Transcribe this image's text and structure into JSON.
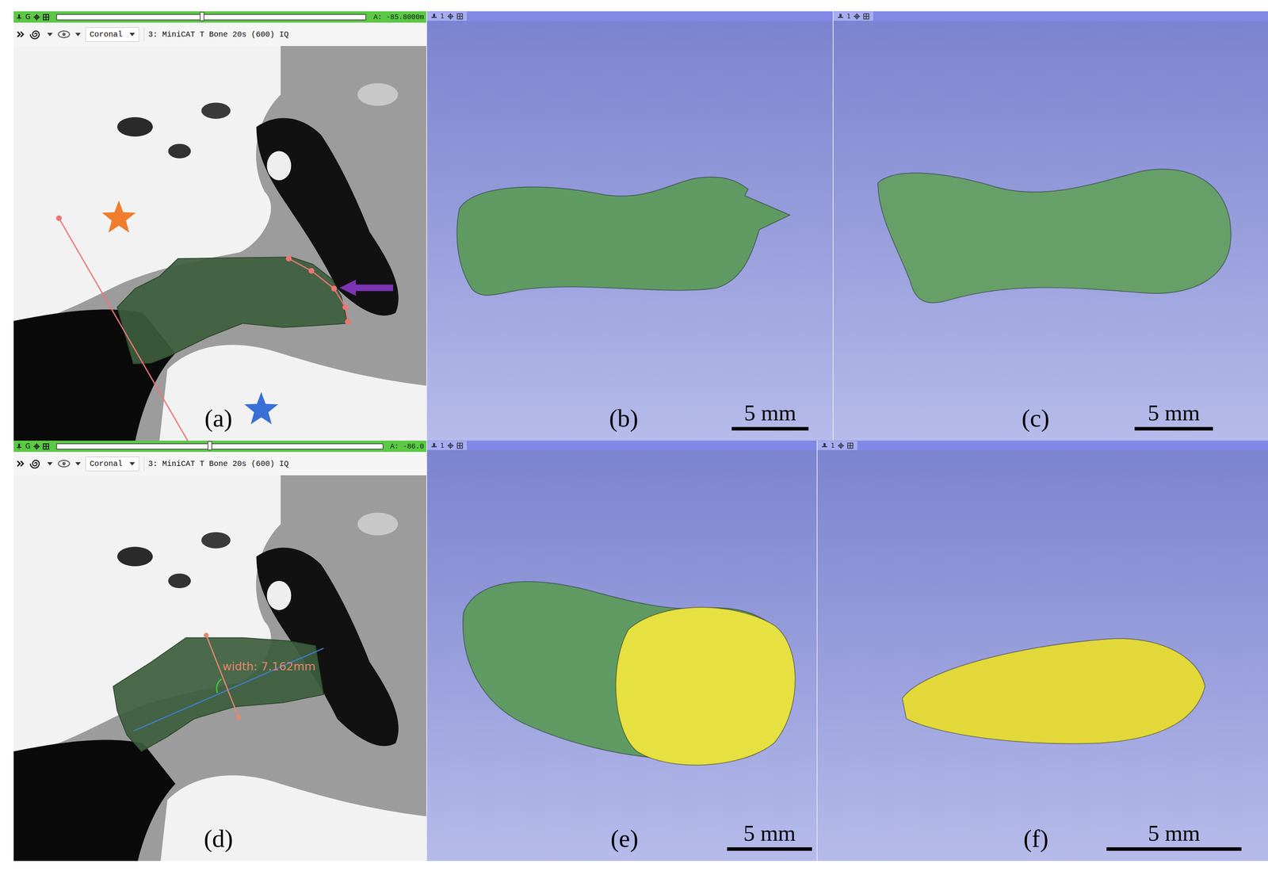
{
  "rows": [
    {
      "panels": [
        {
          "kind": "slice",
          "label": "(a)",
          "shape": "canal-arc",
          "view_letter": "G",
          "slider": {
            "level": 0.47,
            "reading": "A: -85.8000m"
          },
          "orientation": "Coronal",
          "volume": "3: MiniCAT T Bone 20s (600) IQ",
          "segmentation_color": "#3d5e3d",
          "markers": [
            {
              "kind": "star",
              "color": "#ef7d2d"
            },
            {
              "kind": "star",
              "color": "#3a6fd8"
            },
            {
              "kind": "arrow",
              "color": "#7b34b2"
            }
          ],
          "measurements": []
        },
        {
          "kind": "model",
          "label": "(b)",
          "view_number": "1",
          "scale": "5 mm",
          "parts": [
            {
              "shape": "raw-body",
              "color": "#5f9a63"
            }
          ]
        },
        {
          "kind": "model",
          "label": "(c)",
          "view_number": "1",
          "scale": "5 mm",
          "parts": [
            {
              "shape": "smooth-body",
              "color": "#679f69"
            }
          ]
        }
      ]
    },
    {
      "panels": [
        {
          "kind": "slice",
          "label": "(d)",
          "shape": "canal-width",
          "view_letter": "G",
          "slider": {
            "level": 0.47,
            "reading": "A: -86.0"
          },
          "orientation": "Coronal",
          "volume": "3: MiniCAT T Bone 20s (600) IQ",
          "segmentation_color": "#3d5e3d",
          "markers": [],
          "measurements": [
            {
              "text": "width: 7.162mm",
              "color": "#e8866e",
              "axis_color": "#3d80d4"
            }
          ]
        },
        {
          "kind": "model",
          "label": "(e)",
          "view_number": "1",
          "scale": "5 mm",
          "parts": [
            {
              "shape": "capped-body",
              "color": "#5f9a63"
            },
            {
              "shape": "cap-face",
              "color": "#e6e040"
            }
          ]
        },
        {
          "kind": "model",
          "label": "(f)",
          "view_number": "1",
          "scale": "5 mm",
          "parts": [
            {
              "shape": "cap-side",
              "color": "#e2d83a"
            }
          ]
        }
      ]
    }
  ]
}
